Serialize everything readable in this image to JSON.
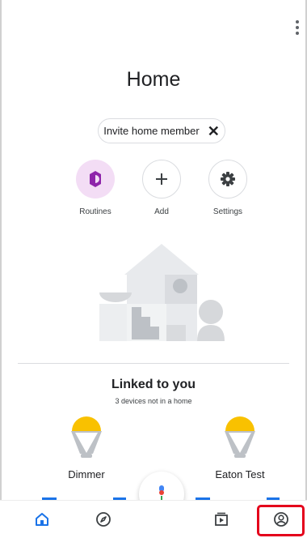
{
  "page": {
    "title": "Home"
  },
  "chip": {
    "label": "Invite home member",
    "close": "✕"
  },
  "actions": [
    {
      "label": "Routines"
    },
    {
      "label": "Add"
    },
    {
      "label": "Settings"
    }
  ],
  "linked": {
    "title": "Linked to you",
    "subtitle": "3 devices not in a home"
  },
  "devices": [
    {
      "name": "Dimmer"
    },
    {
      "name": "Eaton Test"
    }
  ],
  "colors": {
    "accent": "#1a73e8",
    "routines_bg": "#f3ddf5",
    "routines_icon": "#8e24aa",
    "bulb_yellow": "#f9c100",
    "highlight": "#e4001b"
  },
  "nav": {
    "items": [
      {
        "icon": "home-icon",
        "active": true
      },
      {
        "icon": "explore-compass-icon",
        "active": false
      },
      {
        "icon": "media-play-icon",
        "active": false
      },
      {
        "icon": "account-icon",
        "active": false
      }
    ]
  }
}
